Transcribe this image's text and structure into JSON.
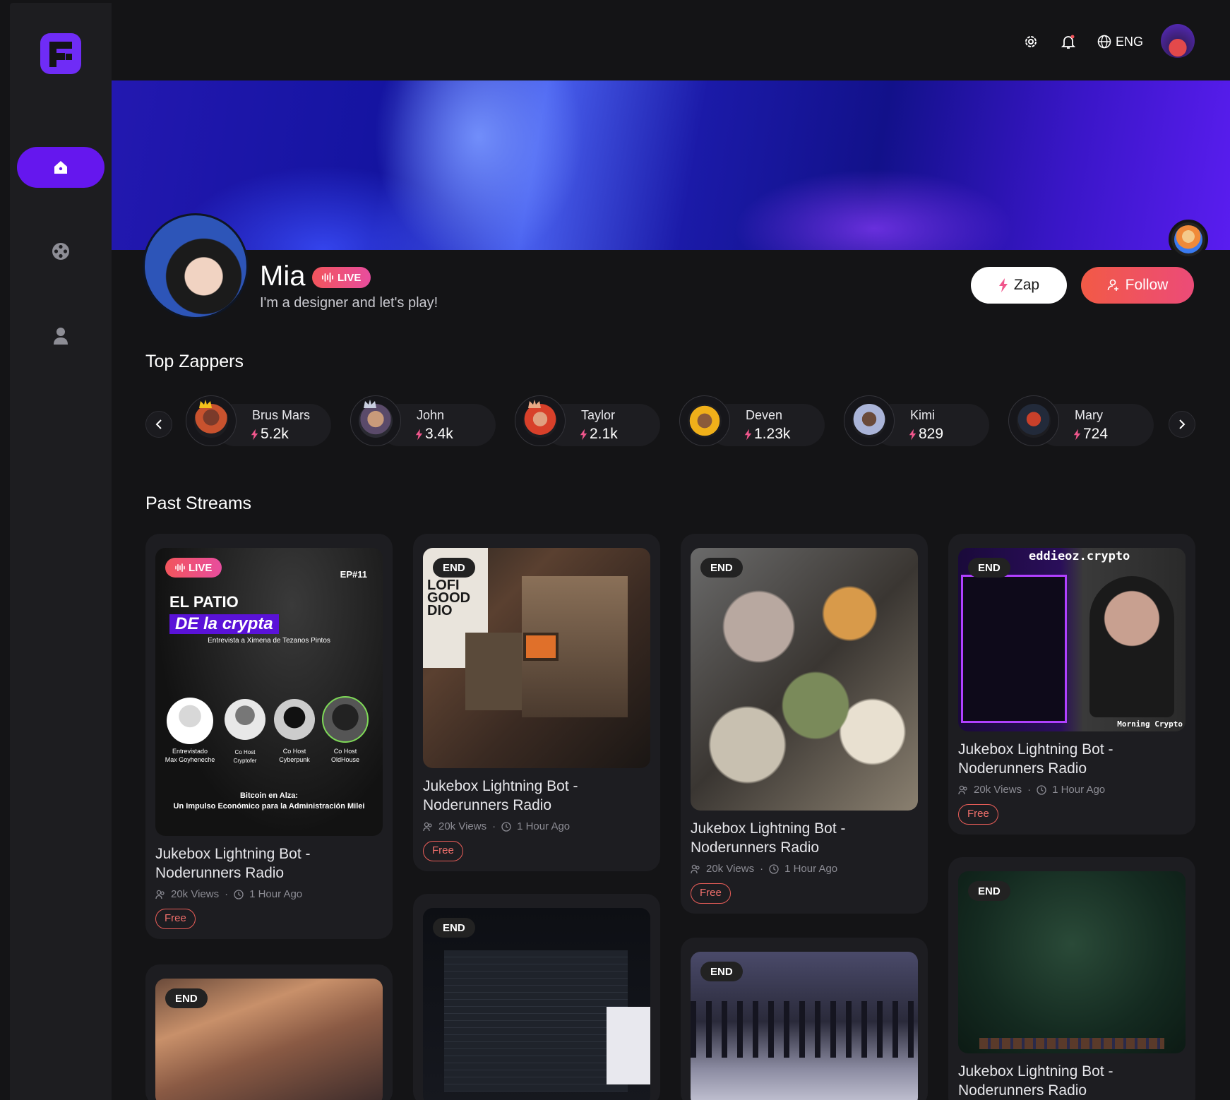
{
  "nav": {
    "items": [
      "home",
      "discover",
      "profile"
    ]
  },
  "topbar": {
    "language": "ENG"
  },
  "profile": {
    "name": "Mia",
    "live_label": "LIVE",
    "bio": "I'm a designer and let's play!",
    "zap_label": "Zap",
    "follow_label": "Follow"
  },
  "top_zappers": {
    "title": "Top Zappers",
    "items": [
      {
        "name": "Brus Mars",
        "amount": "5.2k"
      },
      {
        "name": "John",
        "amount": "3.4k"
      },
      {
        "name": "Taylor",
        "amount": "2.1k"
      },
      {
        "name": "Deven",
        "amount": "1.23k"
      },
      {
        "name": "Kimi",
        "amount": "829"
      },
      {
        "name": "Mary",
        "amount": "724"
      }
    ]
  },
  "past_streams": {
    "title": "Past Streams",
    "cards": [
      {
        "badge": "LIVE",
        "title": "Jukebox Lightning Bot - Noderunners Radio",
        "views": "20k Views",
        "time": "1 Hour Ago",
        "price": "Free",
        "poster": {
          "episode": "EP#11",
          "line1": "EL PATIO",
          "line2": "DE la crypta",
          "subtitle": "Entrevista a Ximena de Tezanos Pintos",
          "guests": [
            {
              "role": "Entrevistado",
              "name": "Max Goyheneche"
            },
            {
              "role": "Co Host",
              "name": "Cryptofer"
            },
            {
              "role": "Co Host",
              "name": "Cyberpunk"
            },
            {
              "role": "Co Host",
              "name": "OldHouse"
            }
          ],
          "footer1": "Bitcoin en Alza:",
          "footer2": "Un Impulso Económico para la Administración Milei"
        }
      },
      {
        "badge": "END",
        "title": "Jukebox Lightning Bot - Noderunners Radio",
        "views": "20k Views",
        "time": "1 Hour Ago",
        "price": "Free",
        "poster": {
          "text": "LOFI GOOD DIO"
        }
      },
      {
        "badge": "END",
        "title": "Jukebox Lightning Bot - Noderunners Radio",
        "views": "20k Views",
        "time": "1 Hour Ago",
        "price": "Free"
      },
      {
        "badge": "END",
        "title": "Jukebox Lightning Bot - Noderunners Radio",
        "views": "20k Views",
        "time": "1 Hour Ago",
        "price": "Free",
        "poster": {
          "text": "eddieoz.crypto",
          "tag": "Morning Crypto"
        }
      },
      {
        "badge": "END"
      },
      {
        "badge": "END"
      },
      {
        "badge": "END"
      },
      {
        "badge": "END",
        "title": "Jukebox Lightning Bot - Noderunners Radio"
      }
    ]
  },
  "colors": {
    "accent": "#6517ee",
    "live": "#f2555c",
    "follow": "#ec4b78",
    "zap_bolt": "#f0568c"
  }
}
